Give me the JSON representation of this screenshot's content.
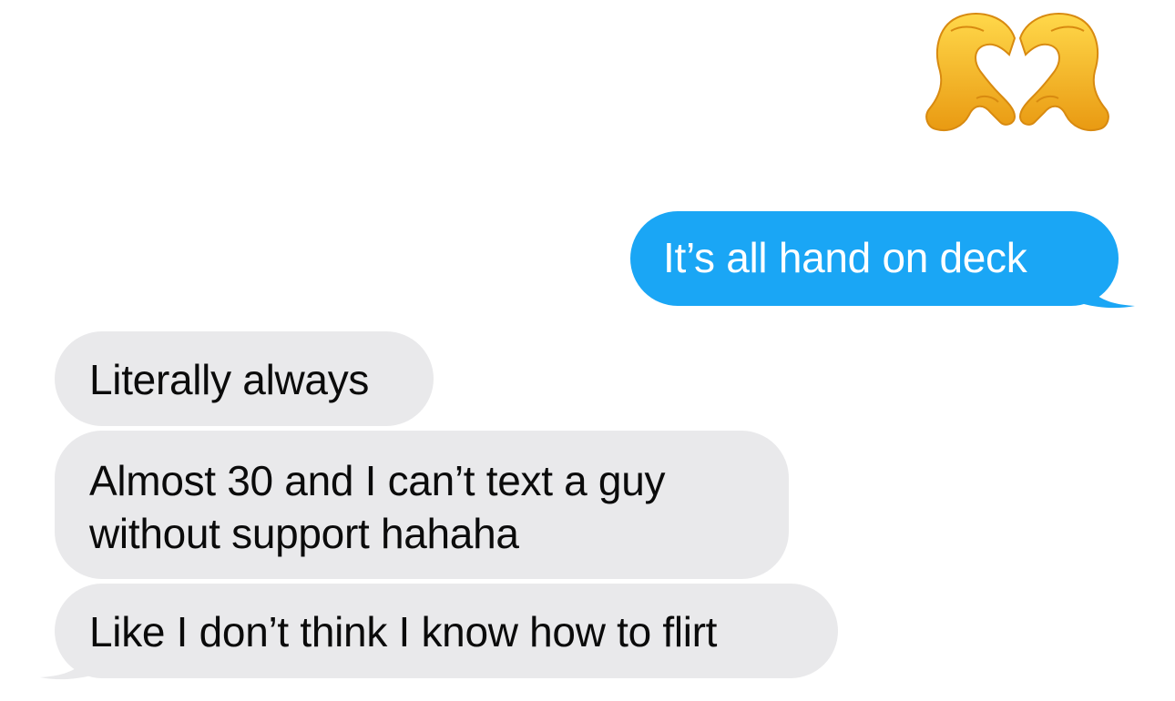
{
  "conversation": {
    "reaction_emoji": "heart-hands-emoji",
    "messages": [
      {
        "sender": "me",
        "text": "It’s all hand on deck"
      },
      {
        "sender": "them",
        "text": "Literally always"
      },
      {
        "sender": "them",
        "lines": [
          "Almost 30 and I can’t text a guy",
          "without support hahaha"
        ]
      },
      {
        "sender": "them",
        "text": "Like I don’t think I know how to flirt"
      }
    ]
  },
  "colors": {
    "sent_bubble": "#1aa6f5",
    "received_bubble": "#e9e9eb",
    "emoji_yellow": "#f6c23a"
  }
}
